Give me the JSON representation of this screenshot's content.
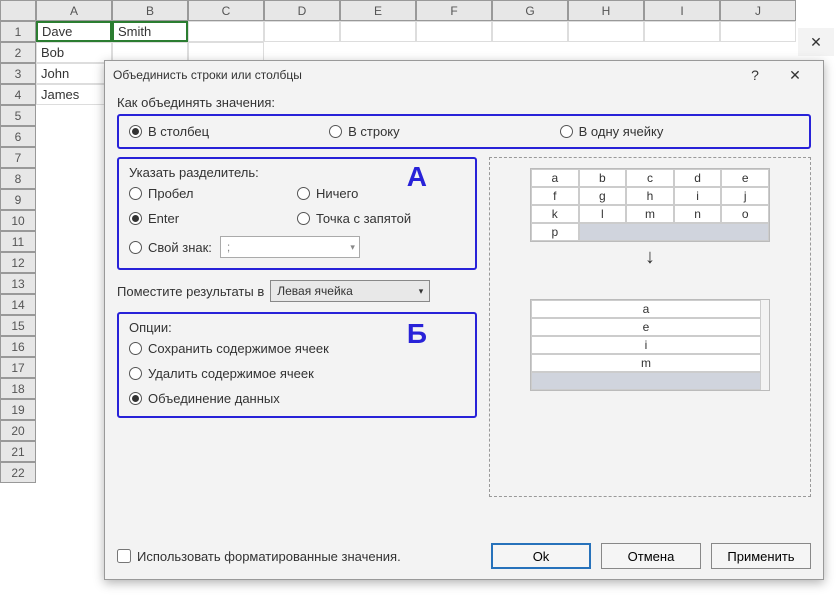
{
  "sheet": {
    "cols": [
      "A",
      "B",
      "C",
      "D",
      "E",
      "F",
      "G",
      "H",
      "I",
      "J"
    ],
    "rows": [
      "1",
      "2",
      "3",
      "4",
      "5",
      "6",
      "7",
      "8",
      "9",
      "10",
      "11",
      "12",
      "13",
      "14",
      "15",
      "16",
      "17",
      "18",
      "19",
      "20",
      "21",
      "22"
    ],
    "data": {
      "A1": "Dave",
      "B1": "Smith",
      "A2": "Bob",
      "A3": "John",
      "A4": "James"
    }
  },
  "dialog": {
    "title": "Объединисть строки или столбцы",
    "help": "?",
    "close": "✕",
    "howLabel": "Как объединять значения:",
    "howOptions": {
      "col": "В столбец",
      "row": "В строку",
      "cell": "В одну ячейку"
    },
    "sepTitle": "Указать разделитель:",
    "sep": {
      "space": "Пробел",
      "nothing": "Ничего",
      "enter": "Enter",
      "semi": "Точка с запятой",
      "custom": "Свой знак:",
      "customVal": ";"
    },
    "letterA": "А",
    "placeLabel": "Поместите результаты в",
    "placeValue": "Левая ячейка",
    "optTitle": "Опции:",
    "opt": {
      "keep": "Сохранить содержимое ячеек",
      "del": "Удалить содержимое ячеек",
      "merge": "Объединение данных"
    },
    "letterB": "Б",
    "chkLabel": "Использовать форматированные значения.",
    "ok": "Ok",
    "cancel": "Отмена",
    "apply": "Применить"
  },
  "preview": {
    "grid": [
      [
        "a",
        "b",
        "c",
        "d",
        "e"
      ],
      [
        "f",
        "g",
        "h",
        "i",
        "j"
      ],
      [
        "k",
        "l",
        "m",
        "n",
        "o"
      ],
      [
        "p",
        "",
        "",
        "",
        ""
      ]
    ],
    "arrow": "↓",
    "result": [
      "a",
      "e",
      "i",
      "m"
    ]
  }
}
